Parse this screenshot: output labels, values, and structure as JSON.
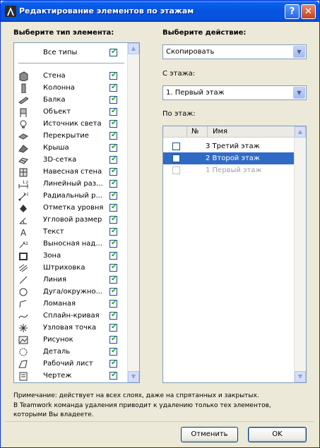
{
  "window": {
    "title": "Редактирование элементов по этажам"
  },
  "titlebar": {
    "help_label": "?",
    "close_label": "✕"
  },
  "left": {
    "label": "Выберите тип элемента:",
    "all_types": "Все типы",
    "types": [
      {
        "label": "Стена",
        "icon": "wall-icon"
      },
      {
        "label": "Колонна",
        "icon": "column-icon"
      },
      {
        "label": "Балка",
        "icon": "beam-icon"
      },
      {
        "label": "Объект",
        "icon": "object-icon"
      },
      {
        "label": "Источник света",
        "icon": "lamp-icon"
      },
      {
        "label": "Перекрытие",
        "icon": "slab-icon"
      },
      {
        "label": "Крыша",
        "icon": "roof-icon"
      },
      {
        "label": "3D-сетка",
        "icon": "mesh-icon"
      },
      {
        "label": "Навесная стена",
        "icon": "curtain-wall-icon"
      },
      {
        "label": "Линейный раз...",
        "icon": "linear-dimension-icon"
      },
      {
        "label": "Радиальный р...",
        "icon": "radial-dimension-icon"
      },
      {
        "label": "Отметка уровня",
        "icon": "level-dimension-icon"
      },
      {
        "label": "Угловой размер",
        "icon": "angle-dimension-icon"
      },
      {
        "label": "Текст",
        "icon": "text-icon"
      },
      {
        "label": "Выносная над...",
        "icon": "label-icon"
      },
      {
        "label": "Зона",
        "icon": "zone-icon"
      },
      {
        "label": "Штриховка",
        "icon": "fill-icon"
      },
      {
        "label": "Линия",
        "icon": "line-icon"
      },
      {
        "label": "Дуга/окружно...",
        "icon": "arc-icon"
      },
      {
        "label": "Ломаная",
        "icon": "polyline-icon"
      },
      {
        "label": "Сплайн-кривая",
        "icon": "spline-icon"
      },
      {
        "label": "Узловая точка",
        "icon": "hotspot-icon"
      },
      {
        "label": "Рисунок",
        "icon": "picture-icon"
      },
      {
        "label": "Деталь",
        "icon": "detail-icon"
      },
      {
        "label": "Рабочий лист",
        "icon": "worksheet-icon"
      },
      {
        "label": "Чертеж",
        "icon": "drawing-icon"
      }
    ]
  },
  "right": {
    "action_label": "Выберите действие:",
    "action_value": "Скопировать",
    "from_label": "С этажа:",
    "from_value": "1. Первый этаж",
    "to_label": "По этаж:",
    "col_num": "№",
    "col_name": "Имя",
    "storeys": [
      {
        "name": "3 Третий этаж",
        "state": "normal"
      },
      {
        "name": "2 Второй этаж",
        "state": "selected"
      },
      {
        "name": "1 Первый этаж",
        "state": "disabled"
      }
    ]
  },
  "note": {
    "line1": "Примечание: действует на всех слоях, даже на спрятанных и закрытых.",
    "line2": "В Teamwork команда удаления приводит к удалению только тех элементов,",
    "line3": "которыми Вы владеете."
  },
  "buttons": {
    "cancel": "Отменить",
    "ok": "OK"
  },
  "colors": {
    "titlebar": "#0553E0",
    "selection": "#316AC5",
    "check": "#21A121"
  }
}
